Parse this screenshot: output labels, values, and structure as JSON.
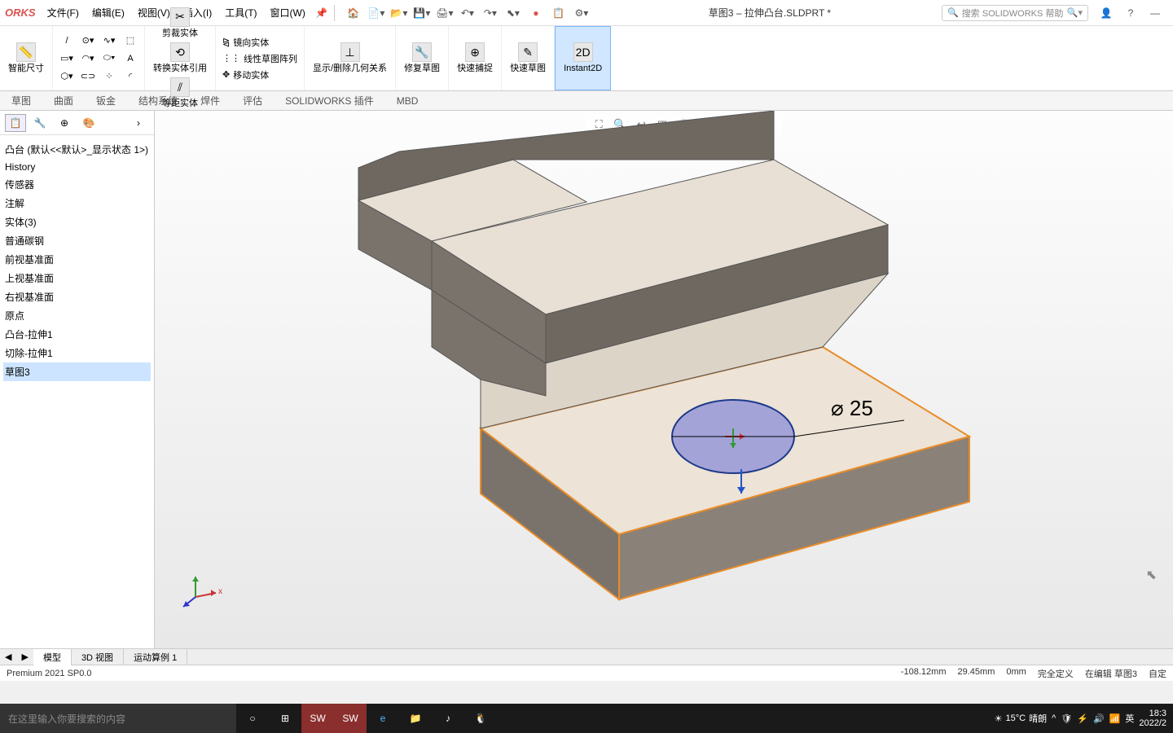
{
  "app": {
    "logo": "ORKS",
    "title": "草图3 – 拉伸凸台.SLDPRT *"
  },
  "menu": {
    "file": "文件(F)",
    "edit": "编辑(E)",
    "view": "视图(V)",
    "insert": "插入(I)",
    "tools": "工具(T)",
    "window": "窗口(W)"
  },
  "search": {
    "placeholder": "搜索 SOLIDWORKS 帮助"
  },
  "ribbon": {
    "smart_dim": "智能尺寸",
    "trim": "剪裁实体",
    "convert": "转换实体引用",
    "offset": "等距实体",
    "mirror": "镜向实体",
    "pattern": "线性草图阵列",
    "move": "移动实体",
    "relations": "显示/删除几何关系",
    "repair": "修复草图",
    "snap": "快速捕捉",
    "rapid": "快速草图",
    "instant": "Instant2D"
  },
  "tabs": {
    "sketch": "草图",
    "surface": "曲面",
    "sheet": "钣金",
    "struct": "结构系统",
    "weld": "焊件",
    "eval": "评估",
    "addins": "SOLIDWORKS 插件",
    "mbd": "MBD"
  },
  "tree": {
    "root": "凸台  (默认<<默认>_显示状态 1>)",
    "history": "History",
    "sensors": "传感器",
    "annot": "注解",
    "solids": "实体(3)",
    "material": "普通碳钢",
    "front": "前视基准面",
    "top": "上视基准面",
    "right": "右视基准面",
    "origin": "原点",
    "boss": "凸台-拉伸1",
    "cut": "切除-拉伸1",
    "sketch3": "草图3"
  },
  "dimension": {
    "dia25": "⌀ 25"
  },
  "triad": {
    "x": "x",
    "y": "",
    "z": ""
  },
  "bottom_tabs": {
    "model": "模型",
    "view3d": "3D 视图",
    "motion": "运动算例 1"
  },
  "status": {
    "version": "Premium 2021 SP0.0",
    "coord_x": "-108.12mm",
    "coord_y": "29.45mm",
    "coord_z": "0mm",
    "defined": "完全定义",
    "editing": "在编辑 草图3",
    "custom": "自定"
  },
  "taskbar": {
    "search_placeholder": "在这里输入你要搜索的内容",
    "weather_temp": "15°C",
    "weather_desc": "晴朗",
    "ime_lang": "英",
    "time": "18:3",
    "date": "2022/2"
  }
}
